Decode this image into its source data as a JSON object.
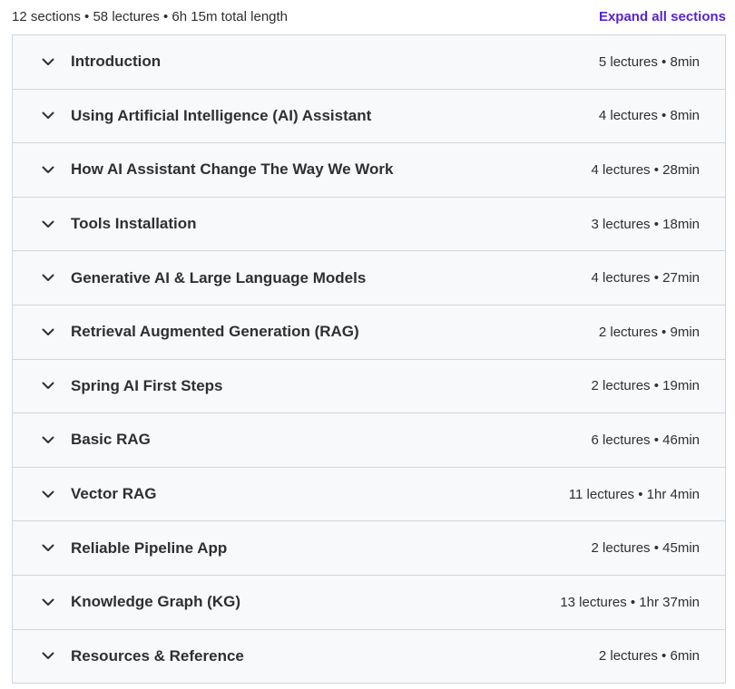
{
  "curriculum": {
    "summary": "12 sections • 58 lectures • 6h 15m total length",
    "expand_all_label": "Expand all sections",
    "sections": [
      {
        "title": "Introduction",
        "meta": "5 lectures • 8min"
      },
      {
        "title": "Using Artificial Intelligence (AI) Assistant",
        "meta": "4 lectures • 8min"
      },
      {
        "title": "How AI Assistant Change The Way We Work",
        "meta": "4 lectures • 28min"
      },
      {
        "title": "Tools Installation",
        "meta": "3 lectures • 18min"
      },
      {
        "title": "Generative AI & Large Language Models",
        "meta": "4 lectures • 27min"
      },
      {
        "title": "Retrieval Augmented Generation (RAG)",
        "meta": "2 lectures • 9min"
      },
      {
        "title": "Spring AI First Steps",
        "meta": "2 lectures • 19min"
      },
      {
        "title": "Basic RAG",
        "meta": "6 lectures • 46min"
      },
      {
        "title": "Vector RAG",
        "meta": "11 lectures • 1hr 4min"
      },
      {
        "title": "Reliable Pipeline App",
        "meta": "2 lectures • 45min"
      },
      {
        "title": "Knowledge Graph (KG)",
        "meta": "13 lectures • 1hr 37min"
      },
      {
        "title": "Resources & Reference",
        "meta": "2 lectures • 6min"
      }
    ]
  },
  "colors": {
    "accent": "#5624d0",
    "text": "#2d2f31",
    "row_bg": "#f7f9fa",
    "border": "#d1d7dc"
  },
  "icons": {
    "section_toggle": "chevron-down-icon"
  }
}
